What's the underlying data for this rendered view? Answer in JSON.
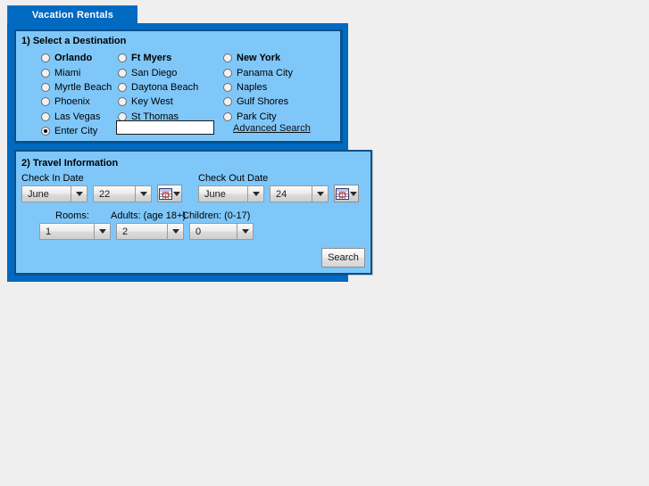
{
  "tab": {
    "label": "Vacation Rentals"
  },
  "destination_panel": {
    "title": "1) Select a Destination",
    "columns": [
      {
        "options": [
          {
            "label": "Orlando",
            "bold": true,
            "selected": false
          },
          {
            "label": "Miami",
            "bold": false,
            "selected": false
          },
          {
            "label": "Myrtle Beach",
            "bold": false,
            "selected": false
          },
          {
            "label": "Phoenix",
            "bold": false,
            "selected": false
          },
          {
            "label": "Las Vegas",
            "bold": false,
            "selected": false
          }
        ]
      },
      {
        "options": [
          {
            "label": "Ft Myers",
            "bold": true,
            "selected": false
          },
          {
            "label": "San Diego",
            "bold": false,
            "selected": false
          },
          {
            "label": "Daytona Beach",
            "bold": false,
            "selected": false
          },
          {
            "label": "Key West",
            "bold": false,
            "selected": false
          },
          {
            "label": "St Thomas",
            "bold": false,
            "selected": false
          }
        ]
      },
      {
        "options": [
          {
            "label": "New York",
            "bold": true,
            "selected": false
          },
          {
            "label": "Panama City",
            "bold": false,
            "selected": false
          },
          {
            "label": "Naples",
            "bold": false,
            "selected": false
          },
          {
            "label": "Gulf Shores",
            "bold": false,
            "selected": false
          },
          {
            "label": "Park City",
            "bold": false,
            "selected": false
          }
        ]
      }
    ],
    "enter_city": {
      "label": "Enter City",
      "selected": true,
      "input_value": "",
      "input_placeholder": ""
    },
    "advanced_search_link": "Advanced Search"
  },
  "travel_panel": {
    "title": "2) Travel Information",
    "check_in_label": "Check In Date",
    "check_out_label": "Check Out Date",
    "check_in_month": "June",
    "check_in_day": "22",
    "check_out_month": "June",
    "check_out_day": "24",
    "rooms_label": "Rooms:",
    "adults_label": "Adults: (age 18+)",
    "children_label": "Children: (0-17)",
    "rooms_value": "1",
    "adults_value": "2",
    "children_value": "0",
    "calendar_icon": "calendar-icon",
    "search_label": "Search"
  },
  "colors": {
    "page_background": "#efeff0",
    "tab_blue": "#0069c0",
    "shell_blue": "#0069c0",
    "panel_blue": "#7fc7f9",
    "panel_border": "#0b4f8a",
    "calendar_marker_red": "#d23a3a"
  }
}
